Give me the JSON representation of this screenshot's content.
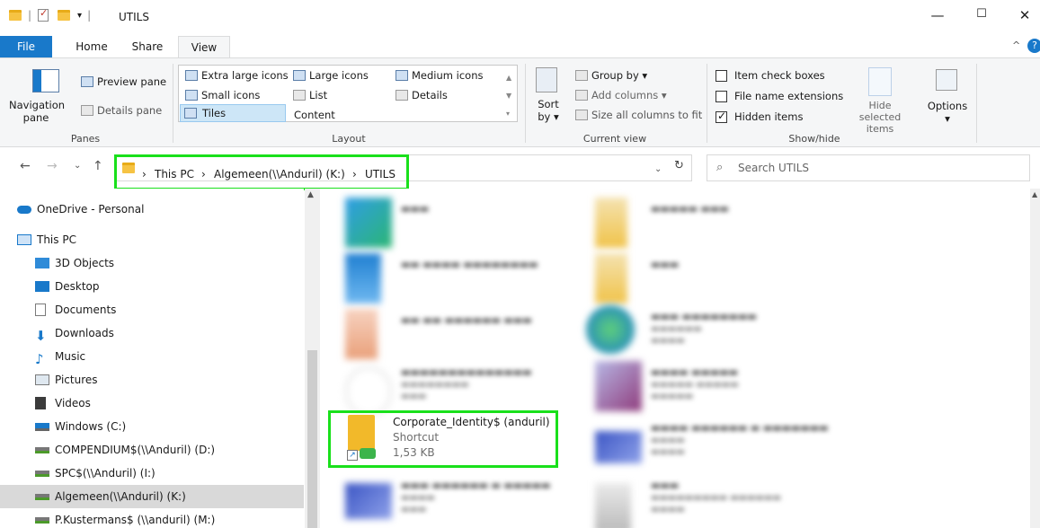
{
  "window": {
    "title": "UTILS"
  },
  "tabs": [
    {
      "label": "File"
    },
    {
      "label": "Home"
    },
    {
      "label": "Share"
    },
    {
      "label": "View"
    }
  ],
  "ribbon": {
    "panes": {
      "label": "Panes",
      "navigation_pane": "Navigation pane",
      "preview_pane": "Preview pane",
      "details_pane": "Details pane"
    },
    "layout": {
      "label": "Layout",
      "options": [
        "Extra large icons",
        "Large icons",
        "Medium icons",
        "Small icons",
        "List",
        "Details",
        "Tiles",
        "Content"
      ],
      "selected": "Tiles"
    },
    "current_view": {
      "label": "Current view",
      "sort_by": "Sort by",
      "group_by": "Group by",
      "add_columns": "Add columns",
      "size_all_columns": "Size all columns to fit"
    },
    "show_hide": {
      "label": "Show/hide",
      "item_check_boxes": "Item check boxes",
      "file_name_extensions": "File name extensions",
      "hidden_items": "Hidden items",
      "hide_selected_items": "Hide selected items",
      "options": "Options",
      "checked": {
        "item_check_boxes": false,
        "file_name_extensions": false,
        "hidden_items": true
      }
    }
  },
  "address": {
    "crumbs": [
      "This PC",
      "Algemeen(\\\\Anduril) (K:)",
      "UTILS"
    ],
    "search_placeholder": "Search UTILS"
  },
  "nav": [
    {
      "label": "OneDrive - Personal",
      "icon": "cloud-icon"
    },
    {
      "label": "This PC",
      "icon": "monitor-icon"
    },
    {
      "label": "3D Objects",
      "icon": "cube-icon"
    },
    {
      "label": "Desktop",
      "icon": "desktop-icon"
    },
    {
      "label": "Documents",
      "icon": "document-icon"
    },
    {
      "label": "Downloads",
      "icon": "download-icon"
    },
    {
      "label": "Music",
      "icon": "music-icon"
    },
    {
      "label": "Pictures",
      "icon": "pictures-icon"
    },
    {
      "label": "Videos",
      "icon": "video-icon"
    },
    {
      "label": "Windows (C:)",
      "icon": "drive-icon"
    },
    {
      "label": "COMPENDIUM$(\\\\Anduril) (D:)",
      "icon": "network-drive-icon"
    },
    {
      "label": "SPC$(\\\\Anduril) (I:)",
      "icon": "network-drive-icon"
    },
    {
      "label": "Algemeen(\\\\Anduril) (K:)",
      "icon": "network-drive-icon",
      "selected": true
    },
    {
      "label": "P.Kustermans$ (\\\\anduril) (M:)",
      "icon": "network-drive-icon"
    }
  ],
  "content": {
    "highlighted_item": {
      "name": "Corporate_Identity$ (anduril)",
      "type": "Shortcut",
      "size": "1,53 KB"
    }
  }
}
